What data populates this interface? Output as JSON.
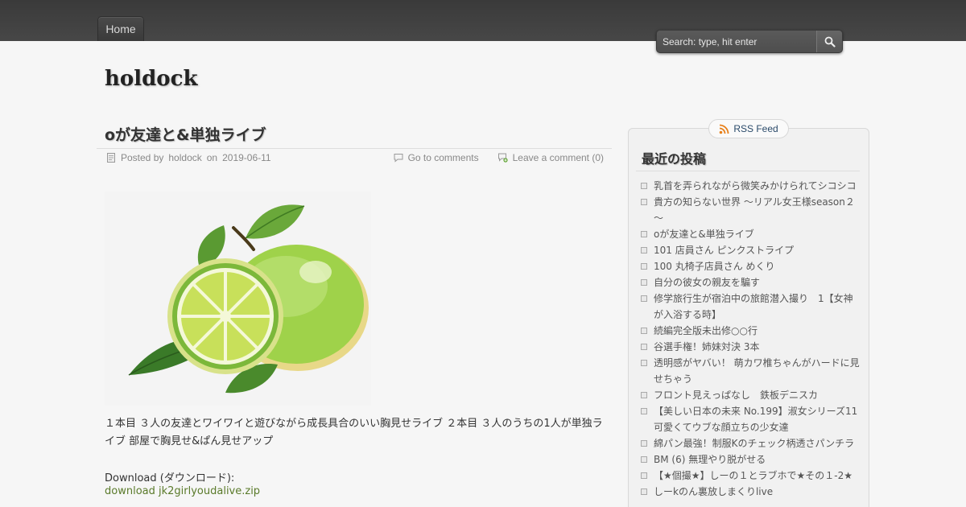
{
  "nav": {
    "home_label": "Home"
  },
  "search": {
    "placeholder": "Search: type, hit enter"
  },
  "site": {
    "title": "holdock"
  },
  "post": {
    "title": "oが友達と&単独ライブ",
    "posted_by_prefix": "Posted by",
    "author": "holdock",
    "on": "on",
    "date": "2019-06-11",
    "comments_link": "Go to comments",
    "leave_comment": "Leave a comment (0)",
    "body": "１本目 ３人の友達とワイワイと遊びながら成長具合のいい胸見せライブ ２本目 ３人のうちの1人が単独ライブ 部屋で胸見せ&ぱん見せアップ",
    "download_label": "Download (ダウンロード):",
    "download_link": "download jk2girlyoudalive.zip"
  },
  "sidebar": {
    "rss_label": "RSS Feed",
    "widget_title": "最近の投稿",
    "recent_posts": [
      "乳首を弄られながら微笑みかけられてシコシコ",
      "貴方の知らない世界 ～リアル女王様season２～",
      "oが友達と&単独ライブ",
      "101 店員さん ピンクストライプ",
      "100 丸椅子店員さん めくり",
      "自分の彼女の親友を騙す",
      "修学旅行生が宿泊中の旅館潜入撮り　1【女神が入浴する時】",
      "続編完全版未出修○○行",
      "谷選手権！姉妹対決 3本",
      "透明感がヤバい！ 萌カワ椎ちゃんがハードに見せちゃう",
      "フロント見えっぱなし　鉄板デニスカ",
      "【美しい日本の未来 No.199】淑女シリーズ11　可愛くてウブな顔立ちの少女達",
      "綿パン最強！制服Kのチェック柄透さパンチラ",
      "BM (6) 無理やり脱がせる",
      "【★個撮★】しーの１とラブホで★その１-2★",
      "しーkのん裏放しまくりlive"
    ]
  },
  "icons": {
    "search": "magnifier-icon",
    "post_meta": "document-icon",
    "comments": "speech-bubble-icon",
    "leave_comment": "comment-add-icon",
    "rss": "rss-icon"
  },
  "colors": {
    "topbar": "#404040",
    "link_green": "#5a7a2a",
    "rss_text": "#2a4a6a"
  }
}
